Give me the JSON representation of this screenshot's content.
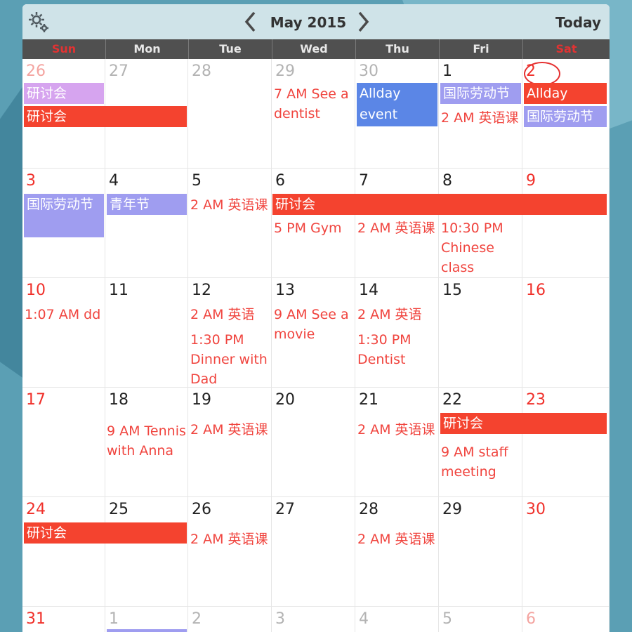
{
  "header": {
    "month_label": "May 2015",
    "today_label": "Today",
    "settings_icon": "gear-icon",
    "prev_icon": "chevron-left-icon",
    "next_icon": "chevron-right-icon"
  },
  "weekdays": [
    "Sun",
    "Mon",
    "Tue",
    "Wed",
    "Thu",
    "Fri",
    "Sat"
  ],
  "colors": {
    "red": "#f0302a",
    "event_red": "#f4432f",
    "event_purple": "#9f9df0",
    "event_lilac": "#d6a4ef",
    "event_blue": "#5b86e6"
  },
  "weeks": [
    [
      "26",
      "27",
      "28",
      "29",
      "30",
      "1",
      "2"
    ],
    [
      "3",
      "4",
      "5",
      "6",
      "7",
      "8",
      "9"
    ],
    [
      "10",
      "11",
      "12",
      "13",
      "14",
      "15",
      "16"
    ],
    [
      "17",
      "18",
      "19",
      "20",
      "21",
      "22",
      "23"
    ],
    [
      "24",
      "25",
      "26",
      "27",
      "28",
      "29",
      "30"
    ],
    [
      "31",
      "1",
      "2",
      "3",
      "4",
      "5",
      "6"
    ]
  ],
  "events": {
    "w0_lilac": "研讨会",
    "w0_red": "研讨会",
    "w0_wed": "7 AM See a dentist",
    "w0_thu": "Allday event",
    "w0_fri_bar": "国际劳动节",
    "w0_fri_text": "2 AM 英语课",
    "w0_sat_red": "Allday",
    "w0_sat_purple": "国际劳动节",
    "w1_sun": "国际劳动节",
    "w1_mon": "青年节",
    "w1_tue": "2 AM 英语课",
    "w1_bar": "研讨会",
    "w1_wed": "5 PM Gym",
    "w1_thu": "2 AM 英语课",
    "w1_fri": "10:30 PM Chinese class",
    "w2_sun": "1:07 AM dd",
    "w2_tue_1": "2 AM 英语",
    "w2_tue_2": "1:30 PM Dinner with Dad",
    "w2_wed": "9 AM See a movie",
    "w2_thu_1": "2 AM 英语",
    "w2_thu_2": "1:30 PM Dentist",
    "w3_mon": "9 AM Tennis with Anna",
    "w3_tue": "2 AM 英语课",
    "w3_thu": "2 AM 英语课",
    "w3_bar": "研讨会",
    "w3_fri": "9 AM staff meeting",
    "w4_bar": "研讨会",
    "w4_tue": "2 AM 英语课",
    "w4_thu": "2 AM 英语课"
  }
}
